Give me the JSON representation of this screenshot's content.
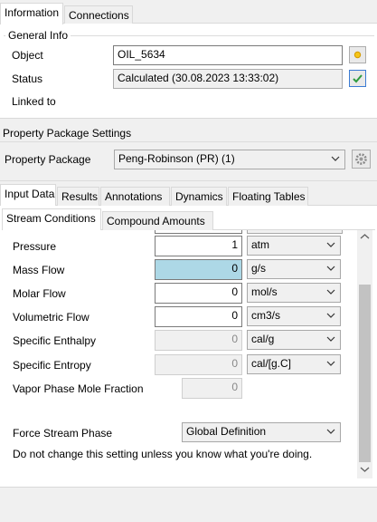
{
  "top_tabs": {
    "information": "Information",
    "connections": "Connections"
  },
  "general_info": {
    "group_title": "General Info",
    "object_label": "Object",
    "object_value": "OIL_5634",
    "status_label": "Status",
    "status_value": "Calculated (30.08.2023 13:33:02)",
    "linked_label": "Linked to"
  },
  "property_package": {
    "group_title": "Property Package Settings",
    "label": "Property Package",
    "selected": "Peng-Robinson (PR) (1)"
  },
  "main_tabs": {
    "input_data": "Input Data",
    "results": "Results",
    "annotations": "Annotations",
    "dynamics": "Dynamics",
    "floating_tables": "Floating Tables"
  },
  "sub_tabs": {
    "stream_conditions": "Stream Conditions",
    "compound_amounts": "Compound Amounts"
  },
  "stream": {
    "pressure": {
      "label": "Pressure",
      "value": "1",
      "unit": "atm"
    },
    "mass_flow": {
      "label": "Mass Flow",
      "value": "0",
      "unit": "g/s"
    },
    "molar_flow": {
      "label": "Molar Flow",
      "value": "0",
      "unit": "mol/s"
    },
    "volumetric_flow": {
      "label": "Volumetric Flow",
      "value": "0",
      "unit": "cm3/s"
    },
    "specific_enthalpy": {
      "label": "Specific Enthalpy",
      "value": "0",
      "unit": "cal/g"
    },
    "specific_entropy": {
      "label": "Specific Entropy",
      "value": "0",
      "unit": "cal/[g.C]"
    },
    "vapor_fraction": {
      "label": "Vapor Phase Mole Fraction",
      "value": "0"
    },
    "force_phase": {
      "label": "Force Stream Phase",
      "value": "Global Definition"
    },
    "warning": "Do not change this setting unless you know what you're doing."
  }
}
